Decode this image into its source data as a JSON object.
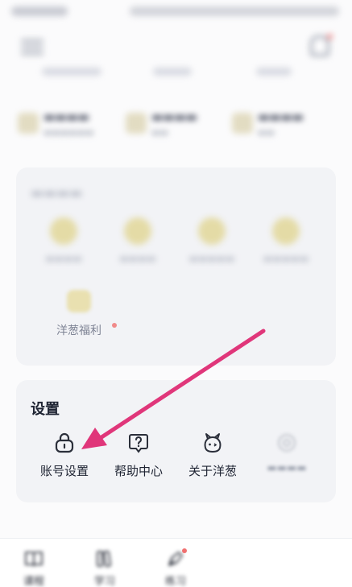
{
  "rights": {
    "welfare_label": "洋葱福利"
  },
  "settings": {
    "title": "设置",
    "items": [
      {
        "label": "账号设置",
        "icon": "lock-icon"
      },
      {
        "label": "帮助中心",
        "icon": "help-bubble-icon"
      },
      {
        "label": "关于洋葱",
        "icon": "onion-mascot-icon"
      },
      {
        "label": "",
        "icon": "gear-icon"
      }
    ]
  },
  "tabbar": {
    "tabs": [
      {
        "label": "课程",
        "icon": "book-icon"
      },
      {
        "label": "学习",
        "icon": "books-icon"
      },
      {
        "label": "练习",
        "icon": "pen-icon"
      }
    ]
  },
  "annotation": {
    "color": "#e0367a",
    "icon": "arrow-icon"
  },
  "colors": {
    "accent_dot": "#f08a8a",
    "card_bg": "#f2f3f6"
  }
}
